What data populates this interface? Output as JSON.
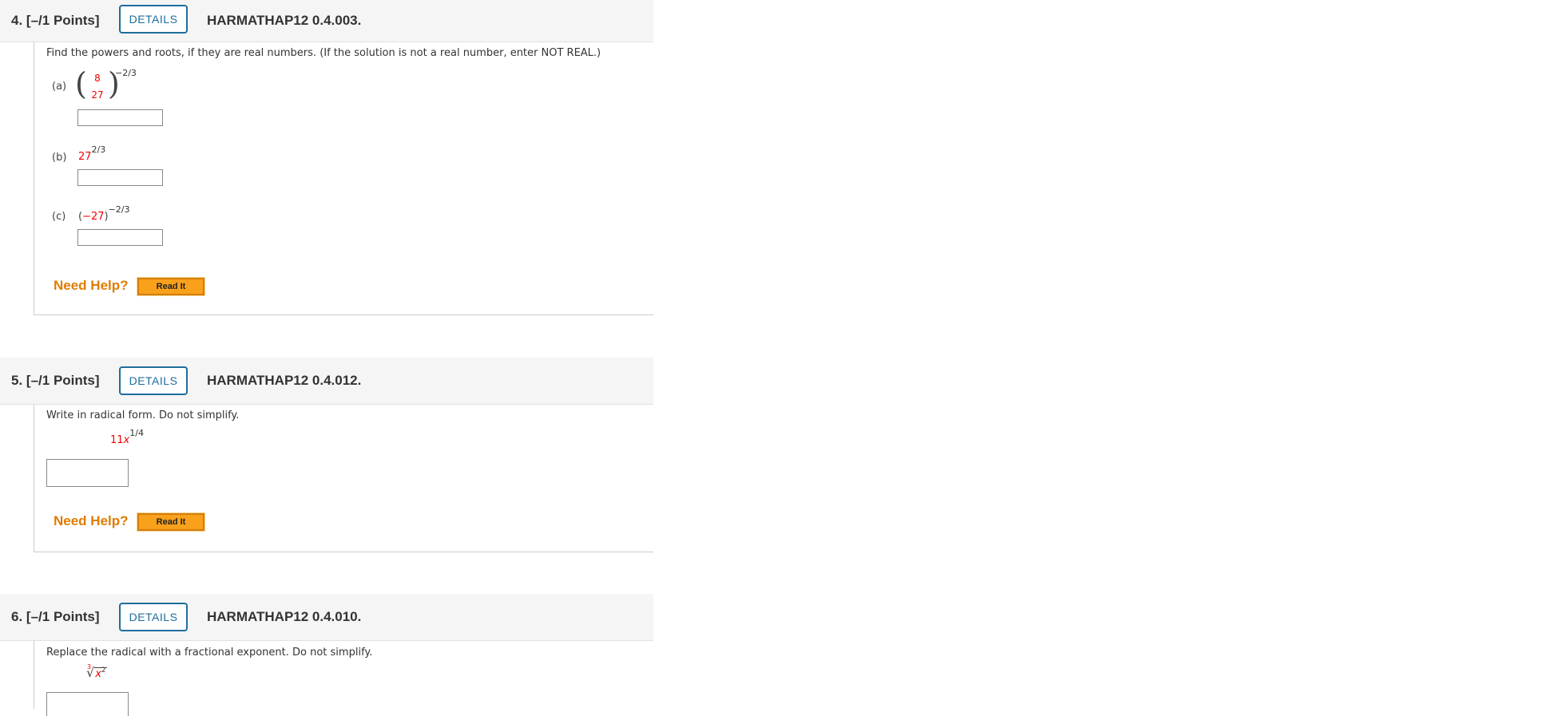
{
  "questions": [
    {
      "number": "4.",
      "points": "[–/1 Points]",
      "details_label": "DETAILS",
      "code": "HARMATHAP12 0.4.003.",
      "instruction": "Find the powers and roots, if they are real numbers. (If the solution is not a real number, enter NOT REAL.)",
      "parts": [
        {
          "label": "(a)",
          "frac_num": "8",
          "frac_den": "27",
          "exponent": "−2/3"
        },
        {
          "label": "(b)",
          "base": "27",
          "exponent": "2/3"
        },
        {
          "label": "(c)",
          "base": "(−27)",
          "base_red": "−27",
          "exponent": "−2/3"
        }
      ],
      "need_help": "Need Help?",
      "read_it": "Read It"
    },
    {
      "number": "5.",
      "points": "[–/1 Points]",
      "details_label": "DETAILS",
      "code": "HARMATHAP12 0.4.012.",
      "instruction": "Write in radical form. Do not simplify.",
      "expr_coef": "11",
      "expr_var": "x",
      "expr_exp": "1/4",
      "need_help": "Need Help?",
      "read_it": "Read It"
    },
    {
      "number": "6.",
      "points": "[–/1 Points]",
      "details_label": "DETAILS",
      "code": "HARMATHAP12 0.4.010.",
      "instruction": "Replace the radical with a fractional exponent. Do not simplify.",
      "radical_index": "3",
      "radical_var": "x",
      "radical_exp": "2"
    }
  ]
}
